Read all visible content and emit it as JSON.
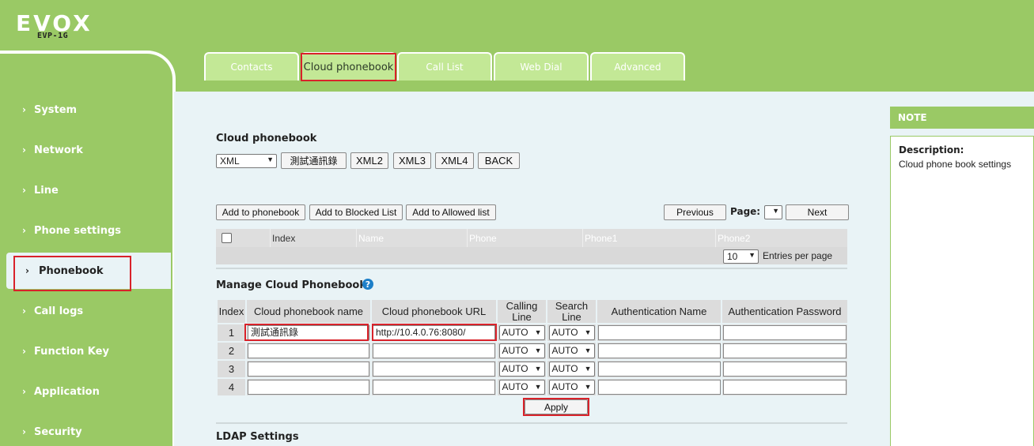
{
  "brand": {
    "name": "EVOX",
    "model": "EVP-1G"
  },
  "sidebar": {
    "items": [
      {
        "label": "System"
      },
      {
        "label": "Network"
      },
      {
        "label": "Line"
      },
      {
        "label": "Phone settings"
      },
      {
        "label": "Phonebook",
        "active": true
      },
      {
        "label": "Call logs"
      },
      {
        "label": "Function Key"
      },
      {
        "label": "Application"
      },
      {
        "label": "Security"
      }
    ]
  },
  "tabs": [
    {
      "label": "Contacts"
    },
    {
      "label": "Cloud phonebook",
      "active": true
    },
    {
      "label": "Call List"
    },
    {
      "label": "Web Dial"
    },
    {
      "label": "Advanced"
    }
  ],
  "cloud_phonebook": {
    "title": "Cloud phonebook",
    "type_select": "XML",
    "book_buttons": [
      "測試通訊錄",
      "XML2",
      "XML3",
      "XML4"
    ],
    "back_label": "BACK"
  },
  "toolbar": {
    "add_phonebook": "Add to phonebook",
    "add_blocked": "Add to Blocked List",
    "add_allowed": "Add to Allowed list",
    "previous": "Previous",
    "page_label": "Page:",
    "page_value": "",
    "next": "Next"
  },
  "contacts_grid": {
    "columns": [
      "Index",
      "Name",
      "Phone",
      "Phone1",
      "Phone2"
    ],
    "entries_value": "10",
    "entries_label": "Entries per page"
  },
  "manage": {
    "title": "Manage Cloud Phonebooks",
    "columns": [
      "Index",
      "Cloud phonebook name",
      "Cloud phonebook URL",
      "Calling Line",
      "Search Line",
      "Authentication Name",
      "Authentication Password"
    ],
    "rows": [
      {
        "index": "1",
        "name": "測試通訊錄",
        "url": "http://10.4.0.76:8080/",
        "calling": "AUTO",
        "search": "AUTO",
        "auth_name": "",
        "auth_pass": ""
      },
      {
        "index": "2",
        "name": "",
        "url": "",
        "calling": "AUTO",
        "search": "AUTO",
        "auth_name": "",
        "auth_pass": ""
      },
      {
        "index": "3",
        "name": "",
        "url": "",
        "calling": "AUTO",
        "search": "AUTO",
        "auth_name": "",
        "auth_pass": ""
      },
      {
        "index": "4",
        "name": "",
        "url": "",
        "calling": "AUTO",
        "search": "AUTO",
        "auth_name": "",
        "auth_pass": ""
      }
    ],
    "apply_label": "Apply"
  },
  "ldap": {
    "title": "LDAP Settings"
  },
  "note": {
    "header": "NOTE",
    "title": "Description:",
    "text": "Cloud phone book settings"
  },
  "colors": {
    "brand_green": "#9ac965",
    "panel_bg": "#e9f3f6",
    "highlight": "#d9222a"
  }
}
